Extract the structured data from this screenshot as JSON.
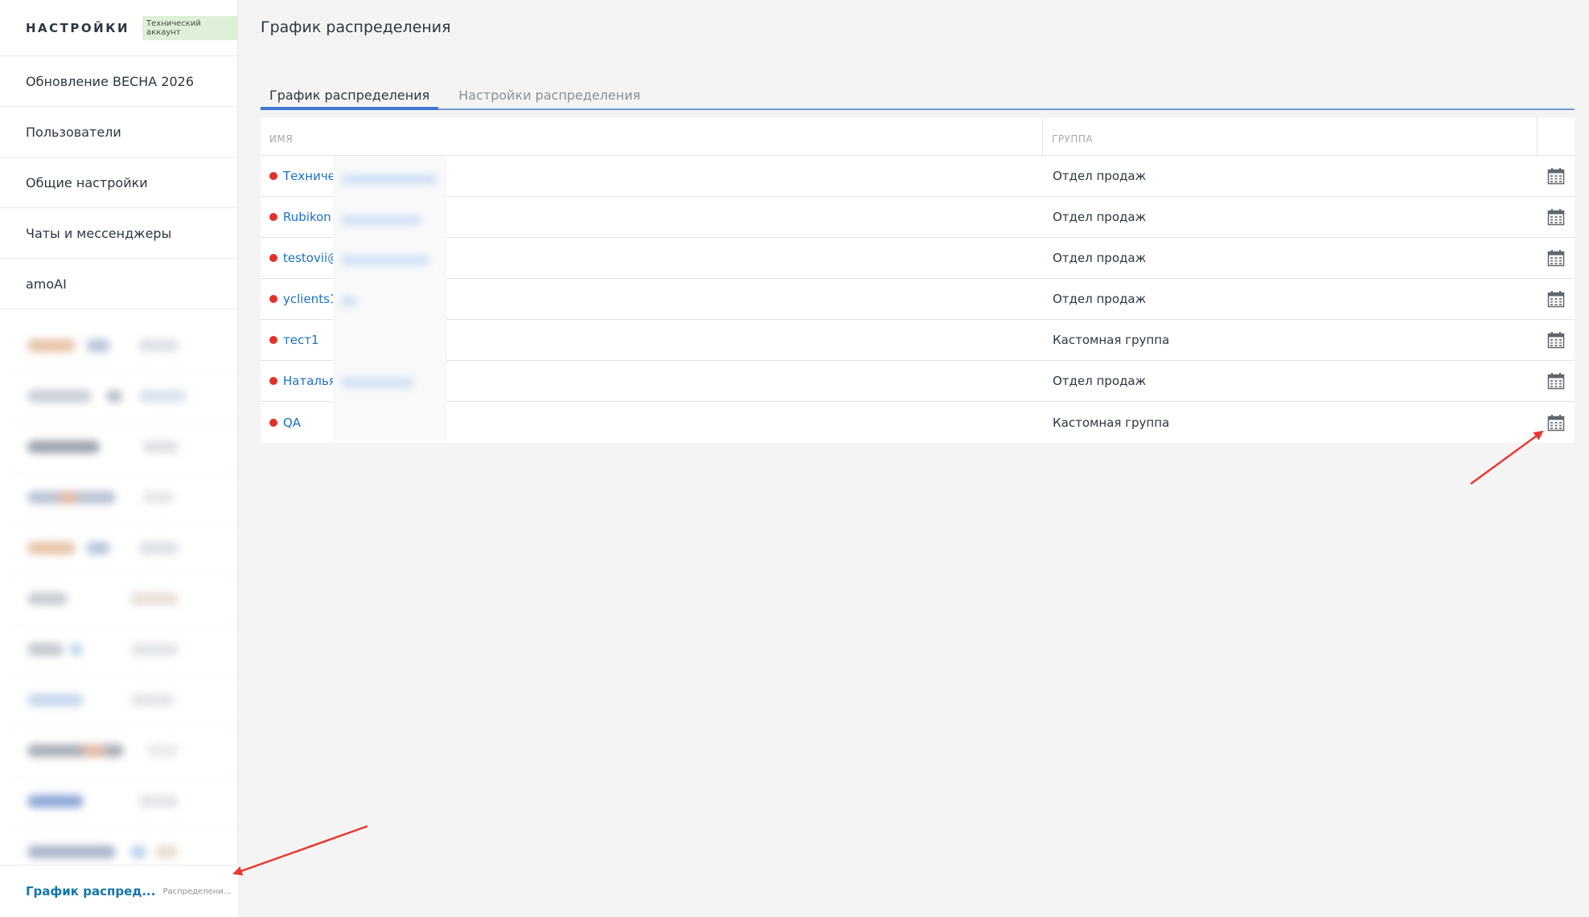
{
  "sidebar": {
    "title": "НАСТРОЙКИ",
    "badge": "Технический аккаунт",
    "items": [
      {
        "label": "Обновление ВЕСНА 2026"
      },
      {
        "label": "Пользователи"
      },
      {
        "label": "Общие настройки"
      },
      {
        "label": "Чаты и мессенджеры"
      },
      {
        "label": "amoAI"
      }
    ],
    "active_item": {
      "label": "График распред...",
      "sublabel": "Распределени..."
    }
  },
  "main": {
    "title": "График распределения",
    "tabs": [
      {
        "label": "График распределения",
        "active": true
      },
      {
        "label": "Настройки распределения",
        "active": false
      }
    ],
    "table": {
      "columns": {
        "name": "ИМЯ",
        "group": "ГРУППА"
      },
      "rows": [
        {
          "name": "Техничес",
          "group": "Отдел продаж"
        },
        {
          "name": "Rubikon",
          "group": "Отдел продаж"
        },
        {
          "name": "testovii@",
          "group": "Отдел продаж"
        },
        {
          "name": "yclients1",
          "group": "Отдел продаж"
        },
        {
          "name": "тест1",
          "group": "Кастомная группа"
        },
        {
          "name": "Наталья",
          "group": "Отдел продаж"
        },
        {
          "name": "QA",
          "group": "Кастомная группа"
        }
      ]
    }
  },
  "colors": {
    "accent": "#4077d6",
    "link": "#1a71c7",
    "status_dot": "#e4302c",
    "annotation_arrow": "#e8392f"
  },
  "icons": {
    "row_action": "calendar-icon"
  }
}
